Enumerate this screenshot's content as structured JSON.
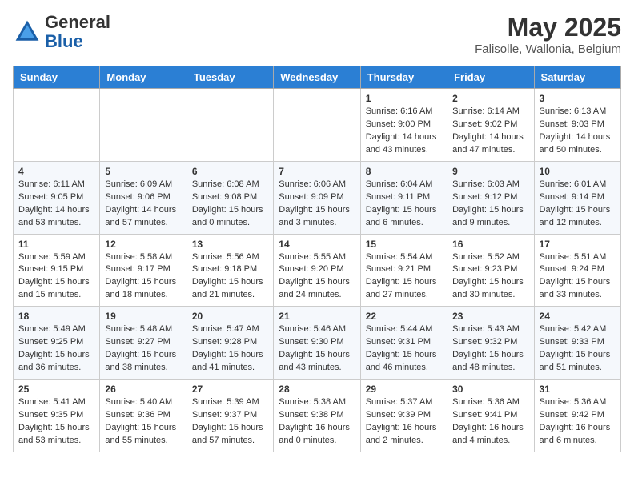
{
  "header": {
    "logo_line1": "General",
    "logo_line2": "Blue",
    "month_title": "May 2025",
    "location": "Falisolle, Wallonia, Belgium"
  },
  "weekdays": [
    "Sunday",
    "Monday",
    "Tuesday",
    "Wednesday",
    "Thursday",
    "Friday",
    "Saturday"
  ],
  "weeks": [
    [
      {
        "day": "",
        "info": ""
      },
      {
        "day": "",
        "info": ""
      },
      {
        "day": "",
        "info": ""
      },
      {
        "day": "",
        "info": ""
      },
      {
        "day": "1",
        "info": "Sunrise: 6:16 AM\nSunset: 9:00 PM\nDaylight: 14 hours\nand 43 minutes."
      },
      {
        "day": "2",
        "info": "Sunrise: 6:14 AM\nSunset: 9:02 PM\nDaylight: 14 hours\nand 47 minutes."
      },
      {
        "day": "3",
        "info": "Sunrise: 6:13 AM\nSunset: 9:03 PM\nDaylight: 14 hours\nand 50 minutes."
      }
    ],
    [
      {
        "day": "4",
        "info": "Sunrise: 6:11 AM\nSunset: 9:05 PM\nDaylight: 14 hours\nand 53 minutes."
      },
      {
        "day": "5",
        "info": "Sunrise: 6:09 AM\nSunset: 9:06 PM\nDaylight: 14 hours\nand 57 minutes."
      },
      {
        "day": "6",
        "info": "Sunrise: 6:08 AM\nSunset: 9:08 PM\nDaylight: 15 hours\nand 0 minutes."
      },
      {
        "day": "7",
        "info": "Sunrise: 6:06 AM\nSunset: 9:09 PM\nDaylight: 15 hours\nand 3 minutes."
      },
      {
        "day": "8",
        "info": "Sunrise: 6:04 AM\nSunset: 9:11 PM\nDaylight: 15 hours\nand 6 minutes."
      },
      {
        "day": "9",
        "info": "Sunrise: 6:03 AM\nSunset: 9:12 PM\nDaylight: 15 hours\nand 9 minutes."
      },
      {
        "day": "10",
        "info": "Sunrise: 6:01 AM\nSunset: 9:14 PM\nDaylight: 15 hours\nand 12 minutes."
      }
    ],
    [
      {
        "day": "11",
        "info": "Sunrise: 5:59 AM\nSunset: 9:15 PM\nDaylight: 15 hours\nand 15 minutes."
      },
      {
        "day": "12",
        "info": "Sunrise: 5:58 AM\nSunset: 9:17 PM\nDaylight: 15 hours\nand 18 minutes."
      },
      {
        "day": "13",
        "info": "Sunrise: 5:56 AM\nSunset: 9:18 PM\nDaylight: 15 hours\nand 21 minutes."
      },
      {
        "day": "14",
        "info": "Sunrise: 5:55 AM\nSunset: 9:20 PM\nDaylight: 15 hours\nand 24 minutes."
      },
      {
        "day": "15",
        "info": "Sunrise: 5:54 AM\nSunset: 9:21 PM\nDaylight: 15 hours\nand 27 minutes."
      },
      {
        "day": "16",
        "info": "Sunrise: 5:52 AM\nSunset: 9:23 PM\nDaylight: 15 hours\nand 30 minutes."
      },
      {
        "day": "17",
        "info": "Sunrise: 5:51 AM\nSunset: 9:24 PM\nDaylight: 15 hours\nand 33 minutes."
      }
    ],
    [
      {
        "day": "18",
        "info": "Sunrise: 5:49 AM\nSunset: 9:25 PM\nDaylight: 15 hours\nand 36 minutes."
      },
      {
        "day": "19",
        "info": "Sunrise: 5:48 AM\nSunset: 9:27 PM\nDaylight: 15 hours\nand 38 minutes."
      },
      {
        "day": "20",
        "info": "Sunrise: 5:47 AM\nSunset: 9:28 PM\nDaylight: 15 hours\nand 41 minutes."
      },
      {
        "day": "21",
        "info": "Sunrise: 5:46 AM\nSunset: 9:30 PM\nDaylight: 15 hours\nand 43 minutes."
      },
      {
        "day": "22",
        "info": "Sunrise: 5:44 AM\nSunset: 9:31 PM\nDaylight: 15 hours\nand 46 minutes."
      },
      {
        "day": "23",
        "info": "Sunrise: 5:43 AM\nSunset: 9:32 PM\nDaylight: 15 hours\nand 48 minutes."
      },
      {
        "day": "24",
        "info": "Sunrise: 5:42 AM\nSunset: 9:33 PM\nDaylight: 15 hours\nand 51 minutes."
      }
    ],
    [
      {
        "day": "25",
        "info": "Sunrise: 5:41 AM\nSunset: 9:35 PM\nDaylight: 15 hours\nand 53 minutes."
      },
      {
        "day": "26",
        "info": "Sunrise: 5:40 AM\nSunset: 9:36 PM\nDaylight: 15 hours\nand 55 minutes."
      },
      {
        "day": "27",
        "info": "Sunrise: 5:39 AM\nSunset: 9:37 PM\nDaylight: 15 hours\nand 57 minutes."
      },
      {
        "day": "28",
        "info": "Sunrise: 5:38 AM\nSunset: 9:38 PM\nDaylight: 16 hours\nand 0 minutes."
      },
      {
        "day": "29",
        "info": "Sunrise: 5:37 AM\nSunset: 9:39 PM\nDaylight: 16 hours\nand 2 minutes."
      },
      {
        "day": "30",
        "info": "Sunrise: 5:36 AM\nSunset: 9:41 PM\nDaylight: 16 hours\nand 4 minutes."
      },
      {
        "day": "31",
        "info": "Sunrise: 5:36 AM\nSunset: 9:42 PM\nDaylight: 16 hours\nand 6 minutes."
      }
    ]
  ]
}
